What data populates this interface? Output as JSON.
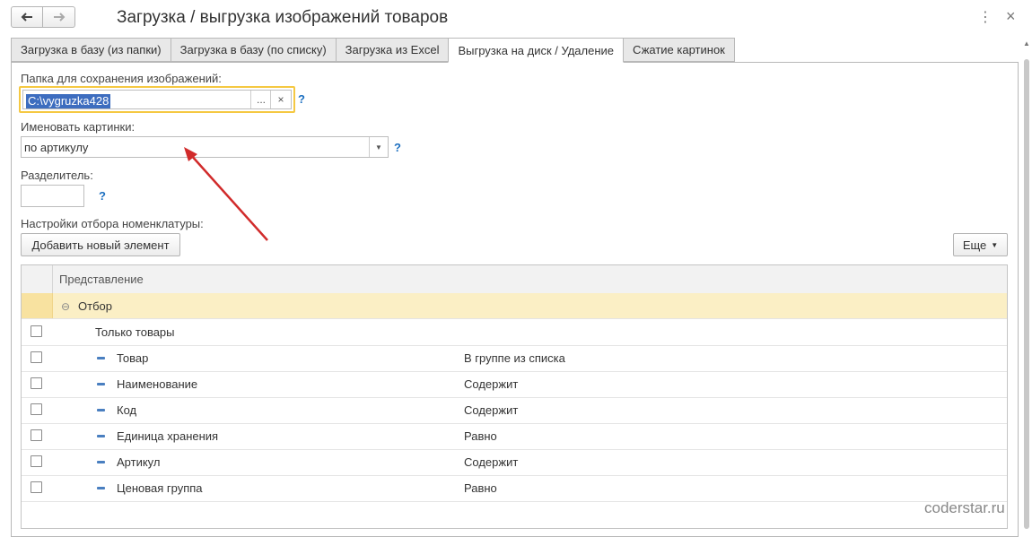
{
  "window": {
    "title": "Загрузка / выгрузка изображений товаров",
    "more_icon": "⋮",
    "close_icon": "×"
  },
  "tabs": [
    {
      "label": "Загрузка в базу (из папки)",
      "active": false
    },
    {
      "label": "Загрузка в базу (по списку)",
      "active": false
    },
    {
      "label": "Загрузка из Excel",
      "active": false
    },
    {
      "label": "Выгрузка на диск / Удаление",
      "active": true
    },
    {
      "label": "Сжатие картинок",
      "active": false
    }
  ],
  "form": {
    "folder_label": "Папка для сохранения изображений:",
    "folder_value": "C:\\vygruzka428",
    "folder_browse": "...",
    "folder_clear": "×",
    "naming_label": "Именовать картинки:",
    "naming_value": "по артикулу",
    "separator_label": "Разделитель:",
    "separator_value": "",
    "filter_label": "Настройки отбора номенклатуры:",
    "help": "?"
  },
  "toolbar": {
    "add_label": "Добавить новый элемент",
    "more_label": "Еще"
  },
  "table": {
    "header": "Представление",
    "group_label": "Отбор",
    "rows": [
      {
        "name": "Только товары",
        "condition": ""
      },
      {
        "name": "Товар",
        "condition": "В группе из списка"
      },
      {
        "name": "Наименование",
        "condition": "Содержит"
      },
      {
        "name": "Код",
        "condition": "Содержит"
      },
      {
        "name": "Единица хранения",
        "condition": "Равно"
      },
      {
        "name": "Артикул",
        "condition": "Содержит"
      },
      {
        "name": "Ценовая группа",
        "condition": "Равно"
      }
    ]
  },
  "watermark": "coderstar.ru",
  "colors": {
    "highlight": "#f5c842",
    "selection": "#3d6dbf",
    "help": "#1c6fc0",
    "arrow": "#d12b2b"
  }
}
